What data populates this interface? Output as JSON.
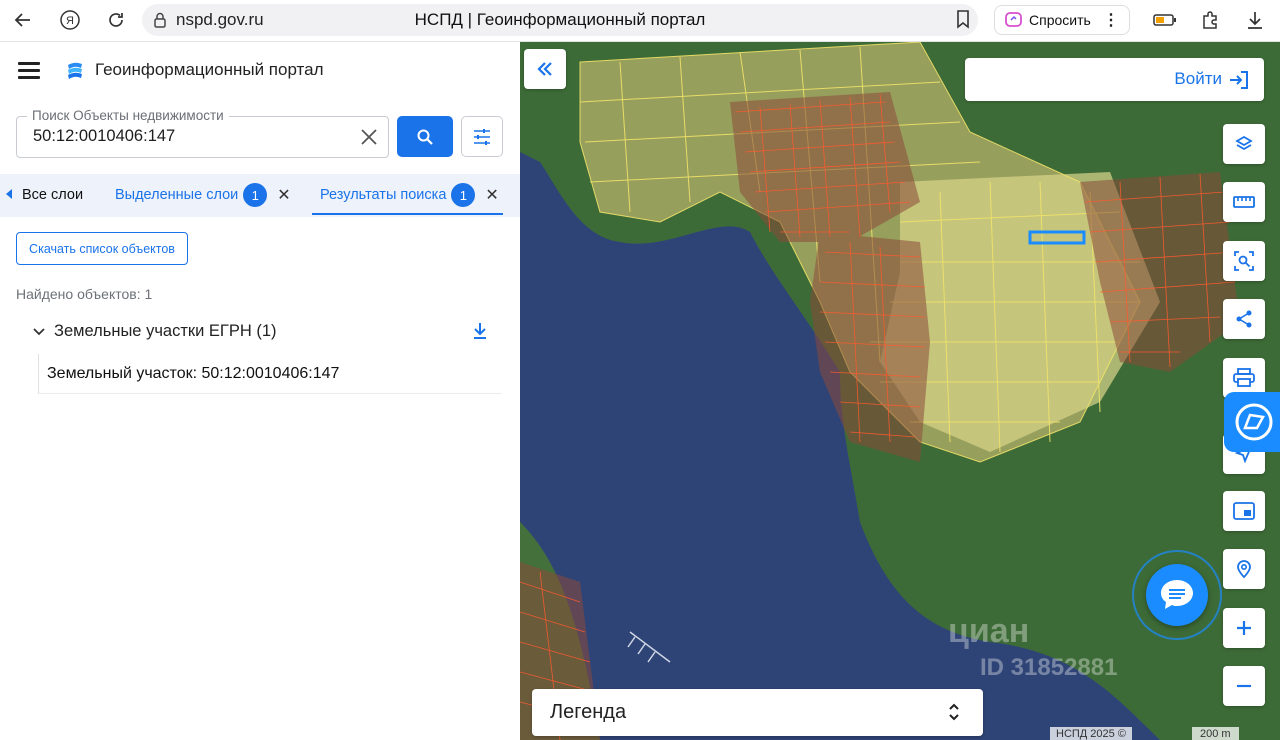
{
  "browser": {
    "domain": "nspd.gov.ru",
    "tab_title": "НСПД | Геоинформационный портал",
    "ask_label": "Спросить"
  },
  "header": {
    "portal_title": "Геоинформационный портал"
  },
  "search": {
    "label": "Поиск Объекты недвижимости",
    "value": "50:12:0010406:147"
  },
  "tabs": {
    "all_layers": "Все слои",
    "selected_layers": "Выделенные слои",
    "selected_count": "1",
    "results": "Результаты поиска",
    "results_count": "1"
  },
  "results": {
    "download_list_label": "Скачать список объектов",
    "found_text": "Найдено объектов: 1",
    "group_title": "Земельные участки ЕГРН (1)",
    "item_label": "Земельный участок: 50:12:0010406:147"
  },
  "map": {
    "login_label": "Войти",
    "legend_label": "Легенда",
    "attribution": "НСПД 2025 ©",
    "scale": "200 m",
    "watermark": "циан",
    "watermark_id": "ID 31852881",
    "colors": {
      "accent": "#1a73e8",
      "forest": "#3f6b3a",
      "water": "#2d3f6f",
      "parcel_yellow": "#e8d96a",
      "parcel_red": "#e04a2a"
    }
  }
}
